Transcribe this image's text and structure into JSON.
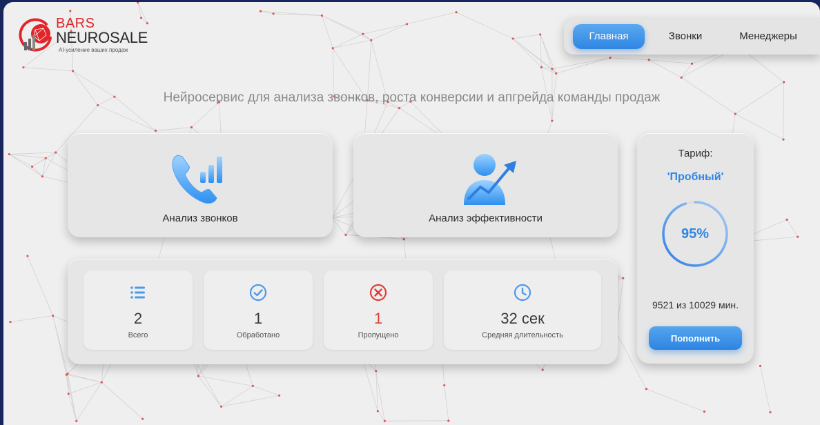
{
  "logo": {
    "brand_top": "BARS",
    "brand_bottom": "NEUROSALE",
    "tagline": "AI-усиление ваших продаж"
  },
  "nav": {
    "items": [
      {
        "label": "Главная",
        "active": true
      },
      {
        "label": "Звонки",
        "active": false
      },
      {
        "label": "Менеджеры",
        "active": false
      }
    ]
  },
  "headline": "Нейросервис для анализа звонков, роста конверсии и апгрейда команды продаж",
  "cards": {
    "calls_label": "Анализ звонков",
    "calls_icon": "phone-signal-icon",
    "efficiency_label": "Анализ эффективности",
    "efficiency_icon": "user-growth-icon"
  },
  "stats": [
    {
      "value": "2",
      "label": "Всего",
      "icon": "list-icon"
    },
    {
      "value": "1",
      "label": "Обработано",
      "icon": "check-circle-icon"
    },
    {
      "value": "1",
      "label": "Пропущено",
      "icon": "x-circle-icon"
    },
    {
      "value": "32 сек",
      "label": "Средняя длительность",
      "icon": "clock-icon"
    }
  ],
  "tariff": {
    "title": "Тариф:",
    "name": "'Пробный'",
    "percent_text": "95%",
    "percent": 95,
    "minutes_text": "9521 из 10029 мин.",
    "topup_label": "Пополнить"
  },
  "colors": {
    "accent": "#2f86e3",
    "danger": "#e53935",
    "background": "#efefef"
  }
}
